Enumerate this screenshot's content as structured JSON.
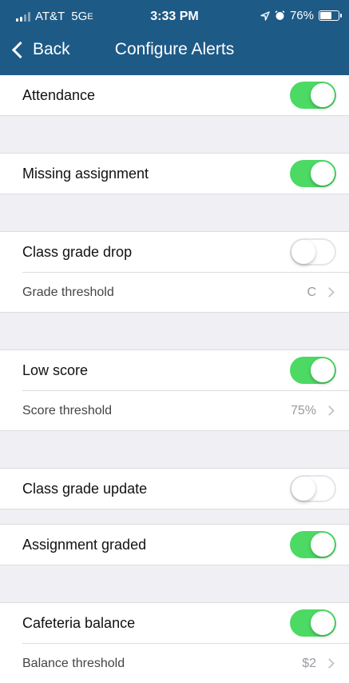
{
  "status": {
    "carrier": "AT&T",
    "network": "5G",
    "network_suffix": "E",
    "time": "3:33 PM",
    "battery": "76%",
    "battery_level": 0.76
  },
  "nav": {
    "back_label": "Back",
    "title": "Configure Alerts"
  },
  "alerts": {
    "attendance": {
      "label": "Attendance",
      "on": true
    },
    "missing_assignment": {
      "label": "Missing assignment",
      "on": true
    },
    "class_grade_drop": {
      "label": "Class grade drop",
      "on": false
    },
    "grade_threshold": {
      "label": "Grade threshold",
      "value": "C"
    },
    "low_score": {
      "label": "Low score",
      "on": true
    },
    "score_threshold": {
      "label": "Score threshold",
      "value": "75%"
    },
    "class_grade_update": {
      "label": "Class grade update",
      "on": false
    },
    "assignment_graded": {
      "label": "Assignment graded",
      "on": true
    },
    "cafeteria_balance": {
      "label": "Cafeteria balance",
      "on": true
    },
    "balance_threshold": {
      "label": "Balance threshold",
      "value": "$2"
    }
  },
  "colors": {
    "header": "#1e5a86",
    "toggle_on": "#4cd964",
    "background": "#efeff4"
  }
}
